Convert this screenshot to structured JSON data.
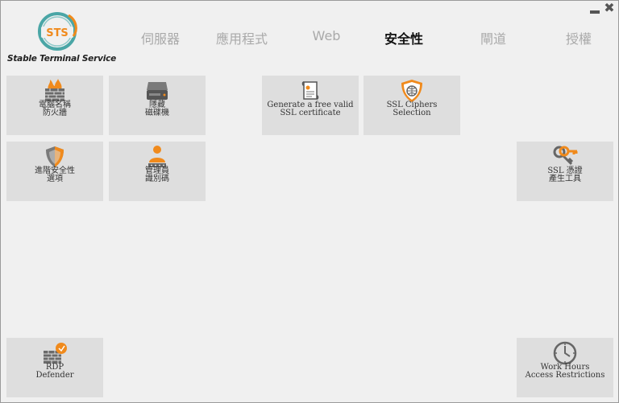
{
  "app": {
    "logo_letters": "STS",
    "name": "Stable Terminal Service"
  },
  "window_controls": {
    "minimize": "minimize",
    "close": "✖"
  },
  "nav": {
    "tabs": [
      {
        "label": "伺服器",
        "active": false
      },
      {
        "label": "應用程式",
        "active": false
      },
      {
        "label": "Web",
        "active": false
      },
      {
        "label": "安全性",
        "active": true
      },
      {
        "label": "閘道",
        "active": false
      },
      {
        "label": "授權",
        "active": false
      }
    ]
  },
  "tiles": {
    "firewall": {
      "label": "電腦名稱\n防火牆",
      "icon": "firewall-icon"
    },
    "hide_drives": {
      "label": "隱藏\n磁碟機",
      "icon": "hard-drive-icon"
    },
    "free_ssl": {
      "label": "Generate a free valid\nSSL certificate",
      "icon": "certificate-icon"
    },
    "ssl_ciphers": {
      "label": "SSL Ciphers\nSelection",
      "icon": "shield-globe-icon"
    },
    "advanced_security": {
      "label": "進階安全性\n選項",
      "icon": "shield-icon"
    },
    "admin_password": {
      "label": "管理員\n識別碼",
      "icon": "admin-user-icon"
    },
    "ssl_cert_tool": {
      "label": "SSL 憑證\n產生工具",
      "icon": "keys-icon"
    },
    "rdp_defender": {
      "label": "RDP\nDefender",
      "icon": "brick-wall-icon"
    },
    "work_hours": {
      "label": "Work Hours\nAccess Restrictions",
      "icon": "clock-icon"
    }
  },
  "colors": {
    "accent": "#f08a1c",
    "logo_teal": "#4aa6a6",
    "tile_bg": "#dedede",
    "inactive_tab": "#a9a9a9"
  }
}
